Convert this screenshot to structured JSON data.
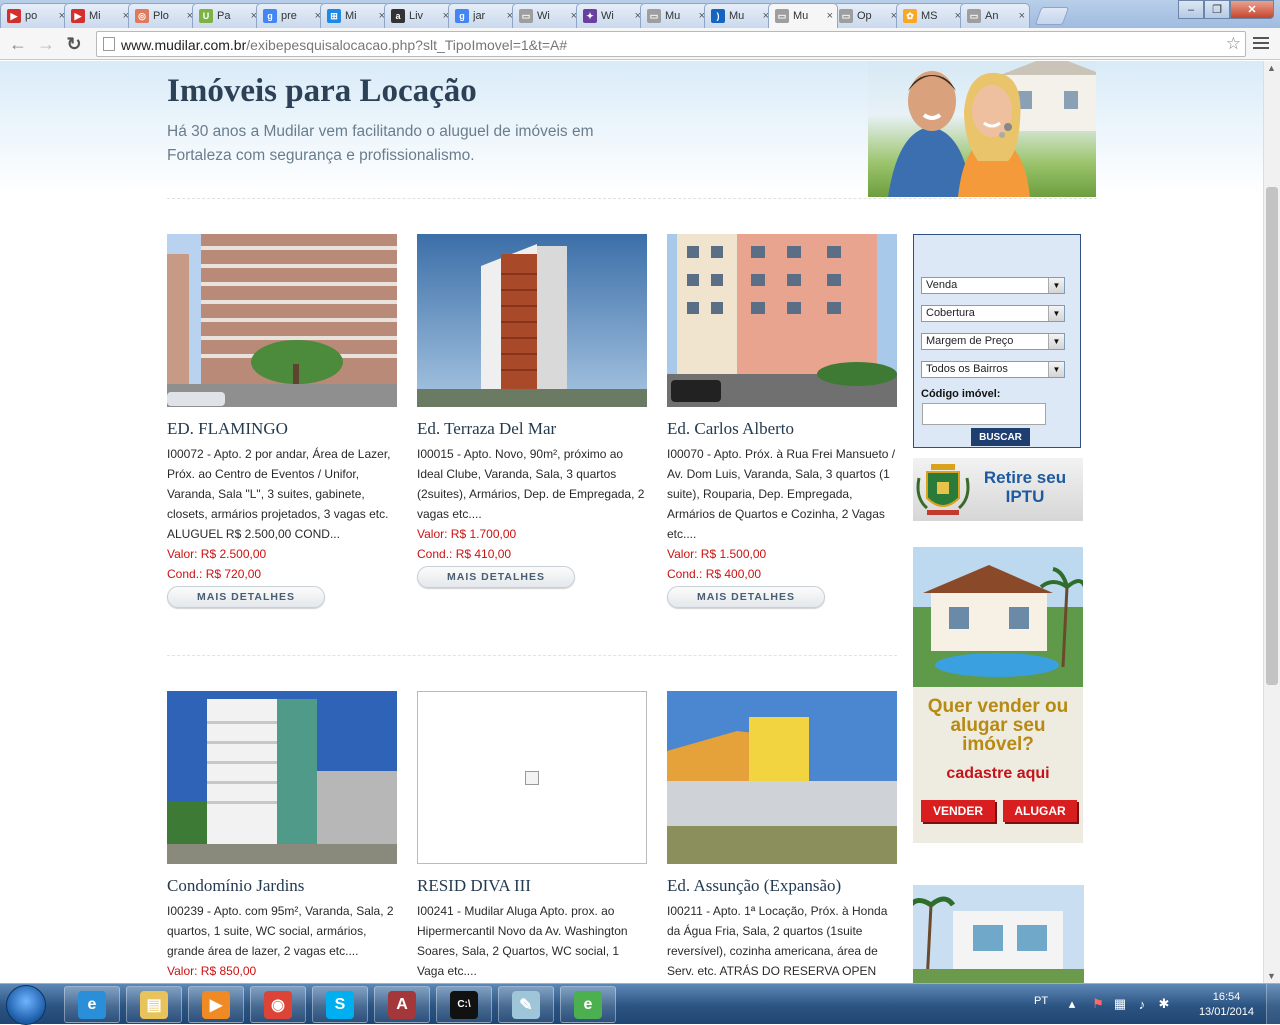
{
  "browser": {
    "tabs": [
      {
        "label": "po",
        "color": "#d32f2f",
        "glyph": "▶"
      },
      {
        "label": "Mi",
        "color": "#d32f2f",
        "glyph": "▶"
      },
      {
        "label": "Plo",
        "color": "#e07a5f",
        "glyph": "◎"
      },
      {
        "label": "Pa",
        "color": "#7cb342",
        "glyph": "U"
      },
      {
        "label": "pre",
        "color": "#4285f4",
        "glyph": "g"
      },
      {
        "label": "Mi",
        "color": "#1e88e5",
        "glyph": "⊞"
      },
      {
        "label": "Liv",
        "color": "#333333",
        "glyph": "a"
      },
      {
        "label": "jar",
        "color": "#4285f4",
        "glyph": "g"
      },
      {
        "label": "Wi",
        "color": "#9e9e9e",
        "glyph": "▭"
      },
      {
        "label": "Wi",
        "color": "#6a3fa0",
        "glyph": "✦"
      },
      {
        "label": "Mu",
        "color": "#9e9e9e",
        "glyph": "▭"
      },
      {
        "label": "Mu",
        "color": "#1565c0",
        "glyph": ")"
      },
      {
        "label": "Mu",
        "color": "#9e9e9e",
        "glyph": "▭",
        "active": true
      },
      {
        "label": "Op",
        "color": "#9e9e9e",
        "glyph": "▭"
      },
      {
        "label": "MS",
        "color": "#f9a825",
        "glyph": "✿"
      },
      {
        "label": "An",
        "color": "#9e9e9e",
        "glyph": "▭"
      }
    ],
    "tab_close": "×",
    "url_host": "www.mudilar.com.br",
    "url_path": "/exibepesquisalocacao.php?slt_TipoImovel=1&t=A#",
    "back_icon": "←",
    "forward_icon": "→",
    "reload_icon": "↻",
    "star_icon": "☆",
    "win_minimize": "–",
    "win_restore": "❐",
    "win_close": "✕"
  },
  "page": {
    "title": "Imóveis para Locação",
    "subtitle": "Há 30 anos a Mudilar vem facilitando o aluguel de imóveis em Fortaleza com segurança e profissionalismo.",
    "details_label": "MAIS DETALHES",
    "listings": [
      {
        "name": "ED. FLAMINGO",
        "description": "I00072 - Apto. 2 por andar, Área de Lazer, Próx. ao Centro de Eventos / Unifor, Varanda, Sala \"L\", 3 suites, gabinete, closets, armários projetados, 3 vagas etc. ALUGUEL R$ 2.500,00 COND...",
        "valor": "Valor: R$ 2.500,00",
        "cond": "Cond.: R$ 720,00"
      },
      {
        "name": "Ed. Terraza Del Mar",
        "description": "I00015 - Apto. Novo, 90m², próximo ao Ideal Clube, Varanda, Sala, 3 quartos (2suites), Armários, Dep. de Empregada, 2 vagas etc....",
        "valor": "Valor: R$ 1.700,00",
        "cond": "Cond.: R$ 410,00"
      },
      {
        "name": "Ed. Carlos Alberto",
        "description": "I00070 - Apto. Próx. à Rua Frei Mansueto / Av. Dom Luis, Varanda, Sala, 3 quartos (1 suite), Rouparia, Dep. Empregada, Armários de Quartos e Cozinha, 2 Vagas etc....",
        "valor": "Valor: R$ 1.500,00",
        "cond": "Cond.: R$ 400,00"
      },
      {
        "name": "Condomínio Jardins",
        "description": "I00239 - Apto. com 95m², Varanda, Sala, 2 quartos, 1 suite, WC social, armários, grande área de lazer, 2 vagas etc....",
        "valor": "Valor: R$ 850,00",
        "cond": ""
      },
      {
        "name": "RESID DIVA III",
        "description": "I00241 - Mudilar Aluga Apto. prox. ao Hipermercantil Novo da Av. Washington Soares, Sala, 2 Quartos, WC social, 1 Vaga etc....",
        "valor": "",
        "cond": ""
      },
      {
        "name": "Ed. Assunção (Expansão)",
        "description": "I00211 - Apto. 1ª Locação, Próx. à Honda da Água Fria, Sala, 2 quartos (1suite reversível), cozinha americana, área de Serv. etc. ATRÁS DO RESERVA OPEN",
        "valor": "",
        "cond": ""
      }
    ],
    "search": {
      "select_negocio": "Venda",
      "select_tipo": "Cobertura",
      "select_preco": "Margem de Preço",
      "select_bairro": "Todos os Bairros",
      "code_label": "Código imóvel:",
      "code_value": "",
      "button": "BUSCAR"
    },
    "iptu": {
      "line1": "Retire seu",
      "line2": "IPTU"
    },
    "banner": {
      "question": "Quer vender ou alugar seu imóvel?",
      "cta": "cadastre aqui",
      "vender": "VENDER",
      "alugar": "ALUGAR"
    }
  },
  "taskbar": {
    "language": "PT",
    "time": "16:54",
    "date": "13/01/2014",
    "apps": [
      {
        "name": "internet-explorer",
        "glyph": "e",
        "color": "#2a8fd8"
      },
      {
        "name": "file-explorer",
        "glyph": "▤",
        "color": "#e8c25a"
      },
      {
        "name": "media-player",
        "glyph": "▶",
        "color": "#f08a24"
      },
      {
        "name": "chrome",
        "glyph": "◉",
        "color": "#db4437"
      },
      {
        "name": "skype",
        "glyph": "S",
        "color": "#00aff0"
      },
      {
        "name": "access",
        "glyph": "A",
        "color": "#a4373a"
      },
      {
        "name": "command-prompt",
        "glyph": "C:\\",
        "color": "#111111"
      },
      {
        "name": "notepad",
        "glyph": "✎",
        "color": "#9ec6d8"
      },
      {
        "name": "browser-e",
        "glyph": "e",
        "color": "#4caf50"
      }
    ]
  }
}
